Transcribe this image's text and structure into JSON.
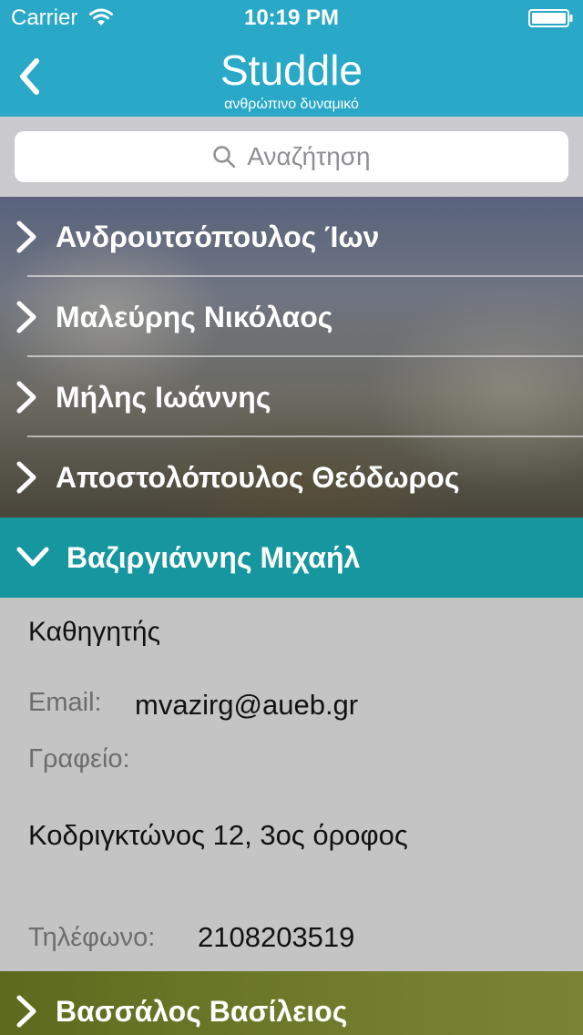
{
  "status_bar": {
    "carrier": "Carrier",
    "time": "10:19 PM"
  },
  "nav": {
    "title": "Studdle",
    "subtitle": "ανθρώπινο δυναμικό"
  },
  "search": {
    "placeholder": "Αναζήτηση"
  },
  "list": {
    "items": [
      {
        "label": "Ανδρουτσόπουλος Ίων"
      },
      {
        "label": "Μαλεύρης Νικόλαος"
      },
      {
        "label": "Μήλης Ιωάννης"
      },
      {
        "label": "Αποστολόπουλος Θεόδωρος"
      }
    ],
    "expanded": {
      "label": "Βαζιργιάννης Μιχαήλ",
      "role": "Καθηγητής",
      "email_label": "Email:",
      "email": "mvazirg@aueb.gr",
      "office_label": "Γραφείο:",
      "address": "Κοδριγκτώνος 12, 3ος όροφος",
      "phone_label": "Τηλέφωνο:",
      "phone": "2108203519"
    },
    "next": {
      "label": "Βασσάλος Βασίλειος"
    }
  },
  "colors": {
    "nav_background": "#29a8c8",
    "expanded_header": "#16969e",
    "detail_background": "#c4c4c4"
  }
}
